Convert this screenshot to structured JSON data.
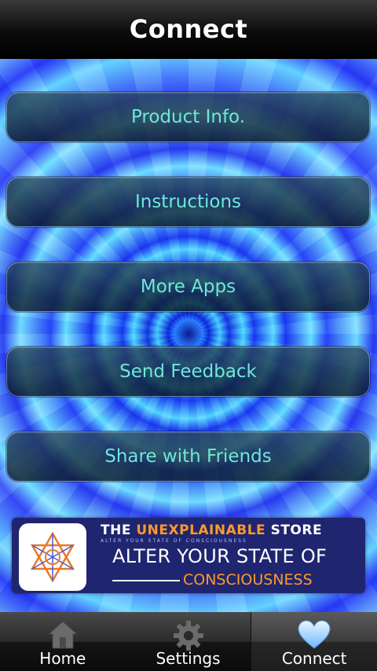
{
  "header": {
    "title": "Connect"
  },
  "menu": [
    {
      "label": "Product Info."
    },
    {
      "label": "Instructions"
    },
    {
      "label": "More Apps"
    },
    {
      "label": "Send Feedback"
    },
    {
      "label": "Share with Friends"
    }
  ],
  "banner": {
    "store_prefix": "THE ",
    "store_accent": "UNEXPLAINABLE",
    "store_suffix": " STORE",
    "tagline": "ALTER YOUR STATE OF CONSCIOUSNESS",
    "line1": "ALTER YOUR STATE OF",
    "line2": "CONSCIOUSNESS",
    "logo_icon": "star-of-david-logo"
  },
  "tabs": [
    {
      "label": "Home",
      "icon": "home-icon",
      "active": false
    },
    {
      "label": "Settings",
      "icon": "gear-icon",
      "active": false
    },
    {
      "label": "Connect",
      "icon": "heart-icon",
      "active": true
    }
  ],
  "colors": {
    "button_text": "#6fe8d8",
    "accent_orange": "#ff9a2a",
    "banner_bg": "#20256f"
  }
}
